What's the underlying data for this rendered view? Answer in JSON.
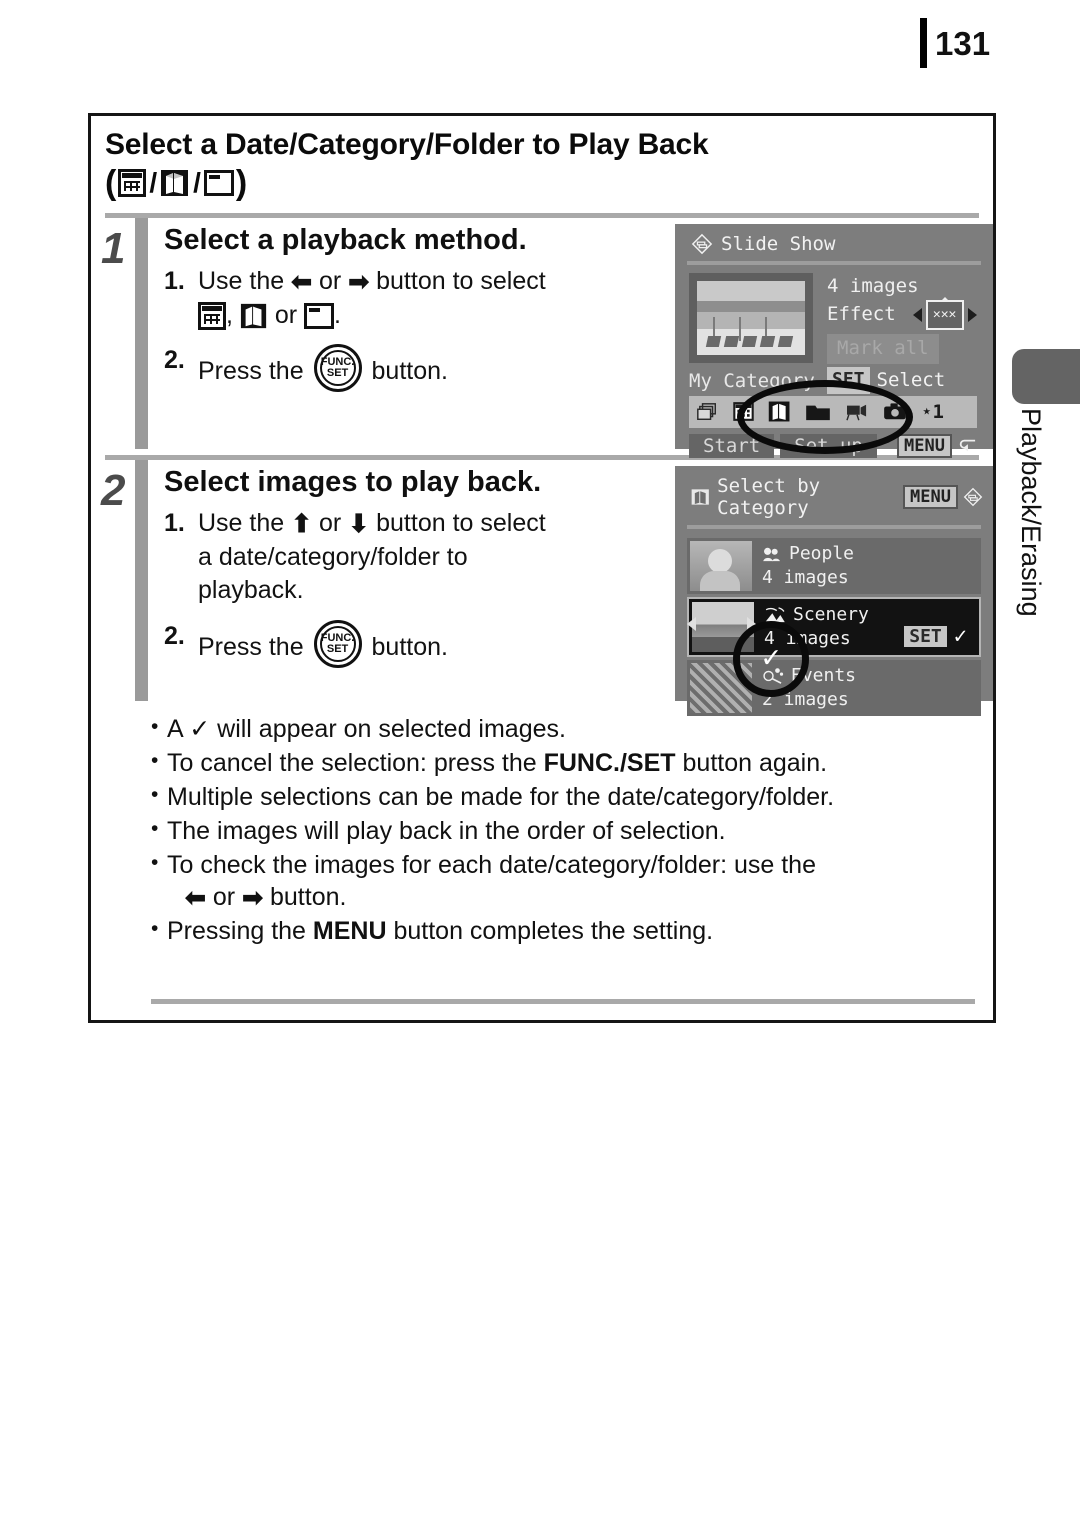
{
  "page": {
    "number": "131"
  },
  "side_tab": {
    "label": "Playback/Erasing"
  },
  "title": {
    "line1": "Select a Date/Category/Folder to Play Back",
    "open_paren": "(",
    "close_paren": ")",
    "slash": "/",
    "icons": [
      "date-calendar-icon",
      "my-category-icon",
      "folder-icon"
    ]
  },
  "steps": [
    {
      "number": "1",
      "heading": "Select a playback method.",
      "substeps": [
        {
          "num": "1.",
          "text_before": "Use the",
          "arrow_left": "←",
          "or": "or",
          "arrow_right": "→",
          "text_after": "button to select",
          "line2_tail": "."
        },
        {
          "num": "2.",
          "text_before": "Press the",
          "text_after": "button."
        }
      ]
    },
    {
      "number": "2",
      "heading": "Select images to play back.",
      "substeps": [
        {
          "num": "1.",
          "text_before": "Use the",
          "arrow_up": "↑",
          "or": "or",
          "arrow_down": "↓",
          "text_after": "button to select",
          "line2": "a date/category/folder to",
          "line3": "playback."
        },
        {
          "num": "2.",
          "text_before": "Press the",
          "text_after": "button."
        }
      ]
    }
  ],
  "lcd_slideshow": {
    "title": "Slide Show",
    "title_icon": "slide-show-icon",
    "image_count": "4 images",
    "effect_label": "Effect",
    "effect_value_icon": "effect-transition-icon",
    "mark_all": "Mark all",
    "set_key": "SET",
    "select_label": "Select",
    "my_category": "My Category",
    "icon_row": [
      "multi-image-icon",
      "date-calendar-icon",
      "my-category-icon",
      "folder-icon",
      "movie-icon",
      "still-image-icon",
      "favorite-star-1-icon"
    ],
    "favorite_label": "⋆1",
    "start_button": "Start",
    "setup_button": "Set up",
    "menu_key": "MENU",
    "back_icon": "return-arrow-icon"
  },
  "lcd_category": {
    "title": "Select by Category",
    "title_icon": "my-category-icon",
    "menu_key": "MENU",
    "menu_back_icon": "slide-show-icon",
    "rows": [
      {
        "icon": "people-icon",
        "name": "People",
        "count": "4 images",
        "selected": false,
        "thumb": "portrait-thumb"
      },
      {
        "icon": "scenery-icon",
        "name": "Scenery",
        "count": "4 images",
        "selected": true,
        "thumb": "landscape-thumb",
        "set_key": "SET",
        "check": "✓"
      },
      {
        "icon": "events-icon",
        "name": "Events",
        "count": "2 images",
        "selected": false,
        "thumb": "event-thumb"
      }
    ]
  },
  "bullets": [
    {
      "parts": [
        {
          "t": "A "
        },
        {
          "t": "✓",
          "style": "check"
        },
        {
          "t": " will appear on selected images."
        }
      ]
    },
    {
      "parts": [
        {
          "t": "To cancel the selection: press the "
        },
        {
          "t": "FUNC./SET",
          "style": "bold"
        },
        {
          "t": " button again."
        }
      ]
    },
    {
      "parts": [
        {
          "t": "Multiple selections can be made for the date/category/folder."
        }
      ]
    },
    {
      "parts": [
        {
          "t": "The images will play back in the order of selection."
        }
      ]
    },
    {
      "parts": [
        {
          "t": "To check the images for each date/category/folder: use the"
        }
      ],
      "second_line": {
        "arrow_left": "←",
        "or": "or",
        "arrow_right": "→",
        "tail": "button."
      }
    },
    {
      "parts": [
        {
          "t": "Pressing the "
        },
        {
          "t": "MENU",
          "style": "bold"
        },
        {
          "t": " button completes the setting."
        }
      ]
    }
  ]
}
